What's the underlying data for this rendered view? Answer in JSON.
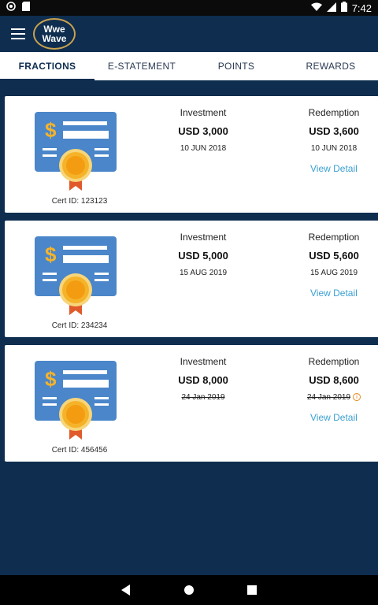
{
  "status_bar": {
    "time": "7:42"
  },
  "app": {
    "logo_line1": "Wwe",
    "logo_line2": "Wave"
  },
  "tabs": [
    {
      "label": "FRACTIONS",
      "active": true
    },
    {
      "label": "E-STATEMENT",
      "active": false
    },
    {
      "label": "POINTS",
      "active": false
    },
    {
      "label": "REWARDS",
      "active": false
    }
  ],
  "labels": {
    "investment": "Investment",
    "redemption": "Redemption",
    "view_detail": "View Detail"
  },
  "cards": [
    {
      "cert_id": "Cert ID: 123123",
      "investment_amount": "USD 3,000",
      "investment_date": "10 JUN 2018",
      "redemption_amount": "USD 3,600",
      "redemption_date": "10 JUN 2018"
    },
    {
      "cert_id": "Cert ID: 234234",
      "investment_amount": "USD 5,000",
      "investment_date": "15 AUG 2019",
      "redemption_amount": "USD 5,600",
      "redemption_date": "15 AUG 2019"
    },
    {
      "cert_id": "Cert ID: 456456",
      "investment_amount": "USD 8,000",
      "investment_date": "24 Jan 2019",
      "redemption_amount": "USD 8,600",
      "redemption_date": "24 Jan 2019"
    }
  ],
  "colors": {
    "primary": "#0e2d4f",
    "accent": "#3ba0d2",
    "cert_blue": "#4a86c9",
    "medal_gold": "#f5b32a",
    "ribbon_red": "#e05a2b"
  }
}
